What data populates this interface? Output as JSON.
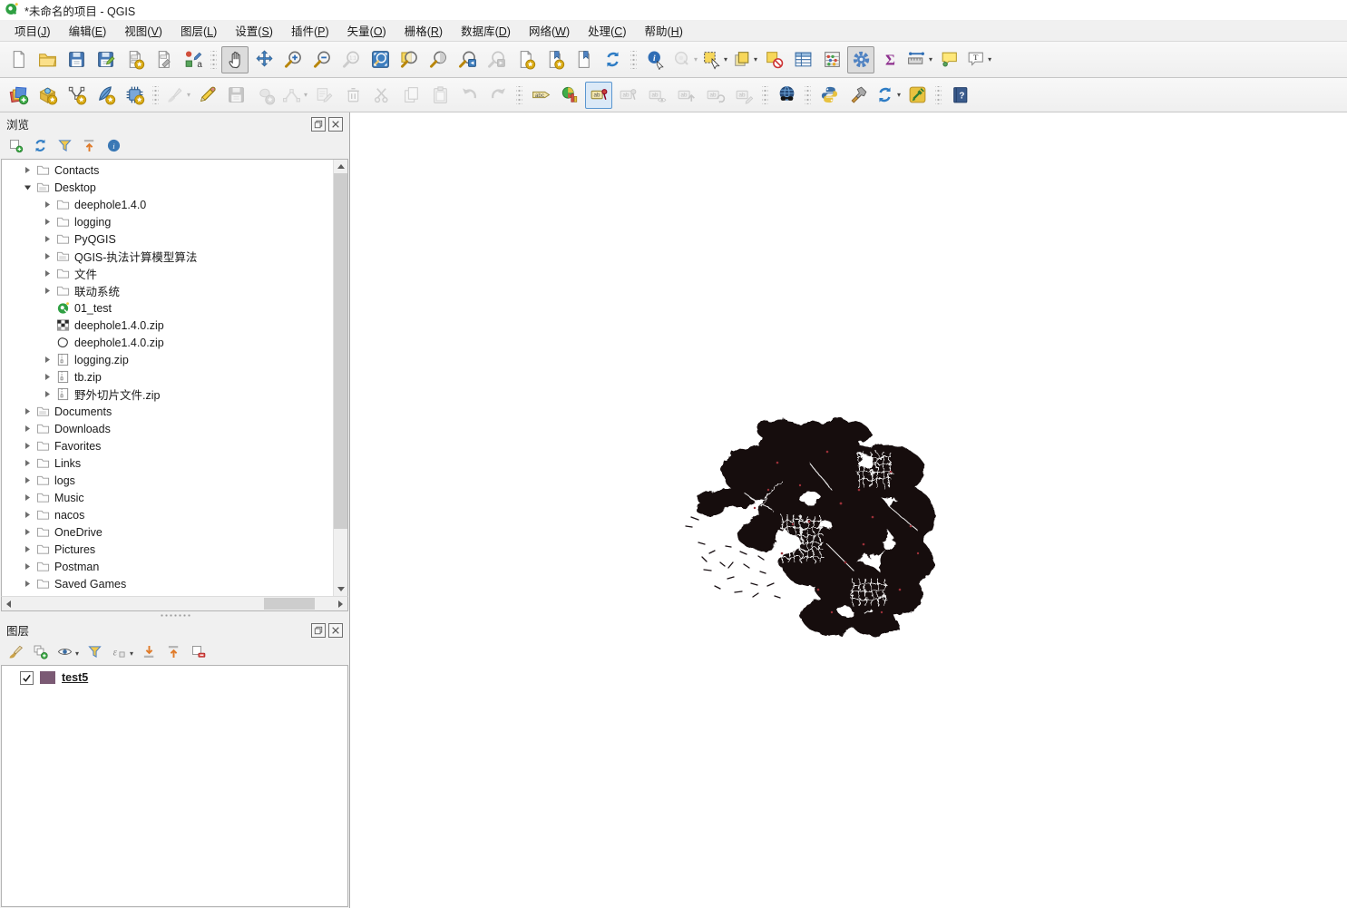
{
  "titlebar": {
    "title": "*未命名的项目 - QGIS",
    "logo_icon": "qgis-logo"
  },
  "menubar": {
    "items": [
      {
        "label": "项目",
        "mnemonic": "J"
      },
      {
        "label": "编辑",
        "mnemonic": "E"
      },
      {
        "label": "视图",
        "mnemonic": "V"
      },
      {
        "label": "图层",
        "mnemonic": "L"
      },
      {
        "label": "设置",
        "mnemonic": "S"
      },
      {
        "label": "插件",
        "mnemonic": "P"
      },
      {
        "label": "矢量",
        "mnemonic": "O"
      },
      {
        "label": "栅格",
        "mnemonic": "R"
      },
      {
        "label": "数据库",
        "mnemonic": "D"
      },
      {
        "label": "网络",
        "mnemonic": "W"
      },
      {
        "label": "处理",
        "mnemonic": "C"
      },
      {
        "label": "帮助",
        "mnemonic": "H"
      }
    ]
  },
  "toolbars": {
    "row1": [
      {
        "icon": "new-project"
      },
      {
        "icon": "open-project"
      },
      {
        "icon": "save-project"
      },
      {
        "icon": "save-project-as"
      },
      {
        "icon": "new-print-layout"
      },
      {
        "icon": "show-layout-manager"
      },
      {
        "icon": "style-manager"
      },
      "sep",
      {
        "icon": "pan-map",
        "state": "active"
      },
      {
        "icon": "pan-to-selection"
      },
      {
        "icon": "zoom-in"
      },
      {
        "icon": "zoom-out"
      },
      {
        "icon": "zoom-native",
        "state": "disabled"
      },
      {
        "icon": "zoom-full"
      },
      {
        "icon": "zoom-to-selection"
      },
      {
        "icon": "zoom-to-layer"
      },
      {
        "icon": "zoom-last"
      },
      {
        "icon": "zoom-next",
        "state": "disabled"
      },
      {
        "icon": "new-map-view"
      },
      {
        "icon": "new-spatial-bookmark"
      },
      {
        "icon": "show-spatial-bookmarks"
      },
      {
        "icon": "refresh-map"
      },
      "sep",
      {
        "icon": "identify-features"
      },
      {
        "icon": "run-feature-action",
        "state": "disabled",
        "dd": true
      },
      {
        "icon": "select-features",
        "dd": true
      },
      {
        "icon": "select-by-form",
        "dd": true
      },
      {
        "icon": "deselect-features"
      },
      {
        "icon": "open-attribute-table"
      },
      {
        "icon": "field-calculator"
      },
      {
        "icon": "processing-toolbox",
        "state": "active"
      },
      {
        "icon": "statistical-summary"
      },
      {
        "icon": "measure",
        "dd": true
      },
      {
        "icon": "map-tips"
      },
      {
        "icon": "text-annotation",
        "dd": true
      }
    ],
    "row2": [
      {
        "icon": "data-source-manager"
      },
      {
        "icon": "new-geopackage-layer"
      },
      {
        "icon": "new-shapefile-layer"
      },
      {
        "icon": "new-spatialite-layer"
      },
      {
        "icon": "new-virtual-layer"
      },
      "sep",
      {
        "icon": "current-edits",
        "state": "disabled",
        "dd": true
      },
      {
        "icon": "toggle-editing"
      },
      {
        "icon": "save-layer-edits",
        "state": "disabled"
      },
      {
        "icon": "digitize-with-segment",
        "state": "disabled"
      },
      {
        "icon": "vertex-tool",
        "state": "disabled",
        "dd": true
      },
      {
        "icon": "modify-attributes",
        "state": "disabled"
      },
      {
        "icon": "delete-selected",
        "state": "disabled"
      },
      {
        "icon": "cut-features",
        "state": "disabled"
      },
      {
        "icon": "copy-features",
        "state": "disabled"
      },
      {
        "icon": "paste-features",
        "state": "disabled"
      },
      {
        "icon": "undo",
        "state": "disabled"
      },
      {
        "icon": "redo",
        "state": "disabled"
      },
      "sep",
      {
        "icon": "layer-labeling"
      },
      {
        "icon": "layer-diagram"
      },
      {
        "icon": "show-pinned-labels",
        "state": "active-blue"
      },
      {
        "icon": "pin-unpin-labels",
        "state": "disabled"
      },
      {
        "icon": "show-hide-labels",
        "state": "disabled"
      },
      {
        "icon": "move-label",
        "state": "disabled"
      },
      {
        "icon": "rotate-label",
        "state": "disabled"
      },
      {
        "icon": "change-label",
        "state": "disabled"
      },
      "sep",
      {
        "icon": "metasearch"
      },
      "sep",
      {
        "icon": "python-console"
      },
      {
        "icon": "plugin-builder"
      },
      {
        "icon": "plugin-reloader",
        "dd": true
      },
      {
        "icon": "quickmapservices-plugin"
      },
      "sep",
      {
        "icon": "help-contents"
      }
    ]
  },
  "browser": {
    "title": "浏览",
    "panel_buttons": [
      "float-icon",
      "close-icon"
    ],
    "tools": [
      "add-selected-layers",
      "refresh",
      "filter-browser",
      "collapse-all",
      "properties-widget"
    ],
    "items": [
      {
        "label": "Contacts",
        "icon": "folder",
        "expander": "collapsed",
        "depth": 1
      },
      {
        "label": "Desktop",
        "icon": "folder-special",
        "expander": "expanded",
        "depth": 1
      },
      {
        "label": "deephole1.4.0",
        "icon": "folder",
        "expander": "collapsed",
        "depth": 2
      },
      {
        "label": "logging",
        "icon": "folder",
        "expander": "collapsed",
        "depth": 2
      },
      {
        "label": "PyQGIS",
        "icon": "folder",
        "expander": "collapsed",
        "depth": 2
      },
      {
        "label": "QGIS-执法计算模型算法",
        "icon": "folder-special",
        "expander": "collapsed",
        "depth": 2
      },
      {
        "label": "文件",
        "icon": "folder",
        "expander": "collapsed",
        "depth": 2
      },
      {
        "label": "联动系统",
        "icon": "folder",
        "expander": "collapsed",
        "depth": 2
      },
      {
        "label": "01_test",
        "icon": "qgis-project",
        "expander": "none",
        "depth": 2
      },
      {
        "label": "deephole1.4.0.zip",
        "icon": "raster",
        "expander": "none",
        "depth": 2
      },
      {
        "label": "deephole1.4.0.zip",
        "icon": "vector",
        "expander": "none",
        "depth": 2
      },
      {
        "label": "logging.zip",
        "icon": "zip",
        "expander": "collapsed",
        "depth": 2
      },
      {
        "label": "tb.zip",
        "icon": "zip",
        "expander": "collapsed",
        "depth": 2
      },
      {
        "label": "野外切片文件.zip",
        "icon": "zip",
        "expander": "collapsed",
        "depth": 2
      },
      {
        "label": "Documents",
        "icon": "folder-special",
        "expander": "collapsed",
        "depth": 1
      },
      {
        "label": "Downloads",
        "icon": "folder",
        "expander": "collapsed",
        "depth": 1
      },
      {
        "label": "Favorites",
        "icon": "folder",
        "expander": "collapsed",
        "depth": 1
      },
      {
        "label": "Links",
        "icon": "folder",
        "expander": "collapsed",
        "depth": 1
      },
      {
        "label": "logs",
        "icon": "folder",
        "expander": "collapsed",
        "depth": 1
      },
      {
        "label": "Music",
        "icon": "folder",
        "expander": "collapsed",
        "depth": 1
      },
      {
        "label": "nacos",
        "icon": "folder",
        "expander": "collapsed",
        "depth": 1
      },
      {
        "label": "OneDrive",
        "icon": "folder",
        "expander": "collapsed",
        "depth": 1
      },
      {
        "label": "Pictures",
        "icon": "folder",
        "expander": "collapsed",
        "depth": 1
      },
      {
        "label": "Postman",
        "icon": "folder",
        "expander": "collapsed",
        "depth": 1
      },
      {
        "label": "Saved Games",
        "icon": "folder",
        "expander": "collapsed",
        "depth": 1
      },
      {
        "label": "",
        "icon": "folder",
        "expander": "collapsed",
        "depth": 1,
        "partial": true
      }
    ]
  },
  "layers": {
    "title": "图层",
    "panel_buttons": [
      "float-icon",
      "close-icon"
    ],
    "tools": [
      "open-layer-styling",
      "add-group",
      "manage-map-themes",
      "filter-legend",
      "filter-by-expression",
      "expand-all",
      "collapse-all",
      "remove-layer"
    ],
    "tool_dropdowns": [
      "manage-map-themes",
      "filter-by-expression"
    ],
    "layer_list": [
      {
        "label": "test5",
        "checked": true,
        "swatch_color": "#7b5a74"
      }
    ]
  },
  "map": {
    "background": "#ffffff"
  }
}
